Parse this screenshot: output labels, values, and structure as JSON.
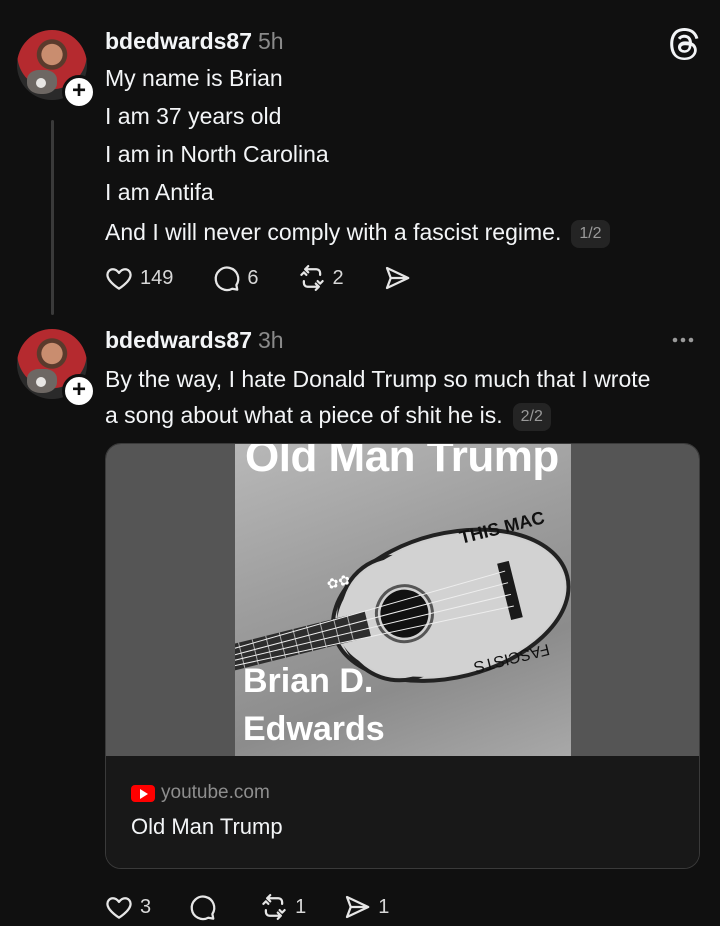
{
  "post1": {
    "username": "bdedwards87",
    "time": "5h",
    "lines": [
      "My name is Brian",
      "I am 37 years old",
      "I am in North Carolina",
      "I am Antifa",
      "And I will never comply with a fascist regime."
    ],
    "pager": "1/2",
    "likes": "149",
    "replies": "6",
    "reposts": "2"
  },
  "post2": {
    "username": "bdedwards87",
    "time": "3h",
    "lines": [
      "By the way, I hate Donald Trump so much that I wrote",
      "a song about what a piece of shit he is."
    ],
    "pager": "2/2",
    "likes": "3",
    "replies": "",
    "reposts": "1",
    "shares": "1"
  },
  "link_card": {
    "thumbnail_title": "Old Man Trump",
    "thumbnail_artist_line1": "Brian D.",
    "thumbnail_artist_line2": "Edwards",
    "guitar_text_top": "THIS MAC",
    "guitar_text_bottom": "FASCISTS ",
    "domain": "youtube.com",
    "title": "Old Man Trump"
  },
  "icons": {
    "like": "heart-icon",
    "reply": "comment-icon",
    "repost": "repost-icon",
    "share": "share-icon",
    "app_logo": "threads-logo-icon",
    "more": "more-options-icon",
    "follow": "plus-icon",
    "source": "youtube-icon"
  },
  "colors": {
    "background": "#101010",
    "text": "#f3f5f7",
    "muted": "#8a8a8a",
    "youtube": "#ff0000"
  }
}
